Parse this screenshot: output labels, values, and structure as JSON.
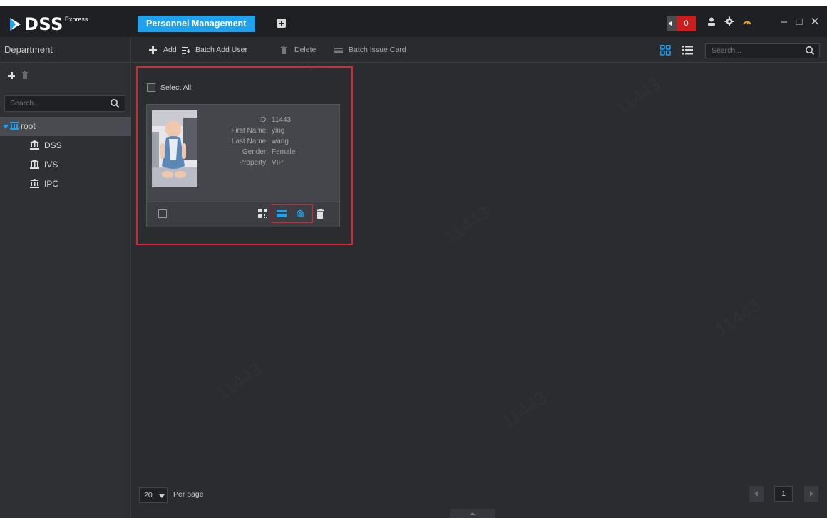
{
  "app": {
    "logo_text": "DSS",
    "logo_sup": "Express",
    "active_tab": "Personnel Management",
    "alarm_count": "0",
    "colors": {
      "accent": "#1ea2f0",
      "alarm": "#c81e1e",
      "highlight_border": "#e0242a"
    }
  },
  "titlebar": {
    "icons": [
      "add-tab-icon",
      "speaker-icon",
      "user-icon",
      "gear-icon",
      "gauge-icon",
      "minimize-icon",
      "maximize-icon",
      "close-icon"
    ],
    "minimize": "–",
    "maximize": "□",
    "close": "✕"
  },
  "sidebar": {
    "title": "Department",
    "search_placeholder": "Search...",
    "tree": [
      {
        "label": "root",
        "selected": true
      },
      {
        "label": "DSS"
      },
      {
        "label": "IVS"
      },
      {
        "label": "IPC"
      }
    ]
  },
  "toolbar": {
    "add": "Add",
    "batch_add": "Batch Add User",
    "delete": "Delete",
    "batch_issue": "Batch Issue Card",
    "search_placeholder": "Search..."
  },
  "content": {
    "select_all": "Select All",
    "card": {
      "fields": [
        {
          "key": "ID:",
          "value": "11443"
        },
        {
          "key": "First Name:",
          "value": "ying"
        },
        {
          "key": "Last Name:",
          "value": "wang"
        },
        {
          "key": "Gender:",
          "value": "Female"
        },
        {
          "key": "Property:",
          "value": "VIP"
        }
      ]
    }
  },
  "footer": {
    "per_page_value": "20",
    "per_page_label": "Per page",
    "current_page": "1"
  },
  "watermark": "11443"
}
